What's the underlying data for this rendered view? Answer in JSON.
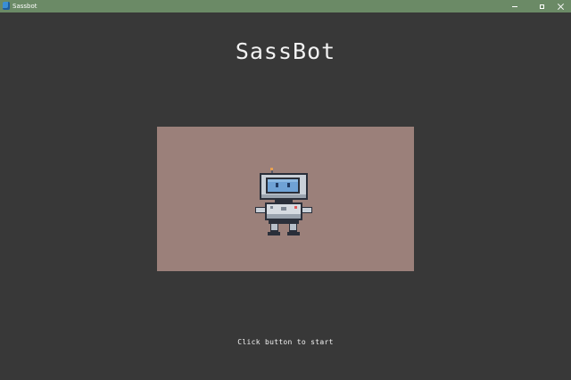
{
  "window": {
    "title": "Sassbot",
    "controls": [
      "minimize-icon",
      "maximize-icon",
      "close-icon"
    ],
    "colors": {
      "titlebar": "#6b8a66",
      "background": "#383838",
      "stage": "#9b807a"
    }
  },
  "app": {
    "title": "SassBot",
    "hint": "Click button to start"
  },
  "stage": {
    "sprite": "robot-icon"
  }
}
